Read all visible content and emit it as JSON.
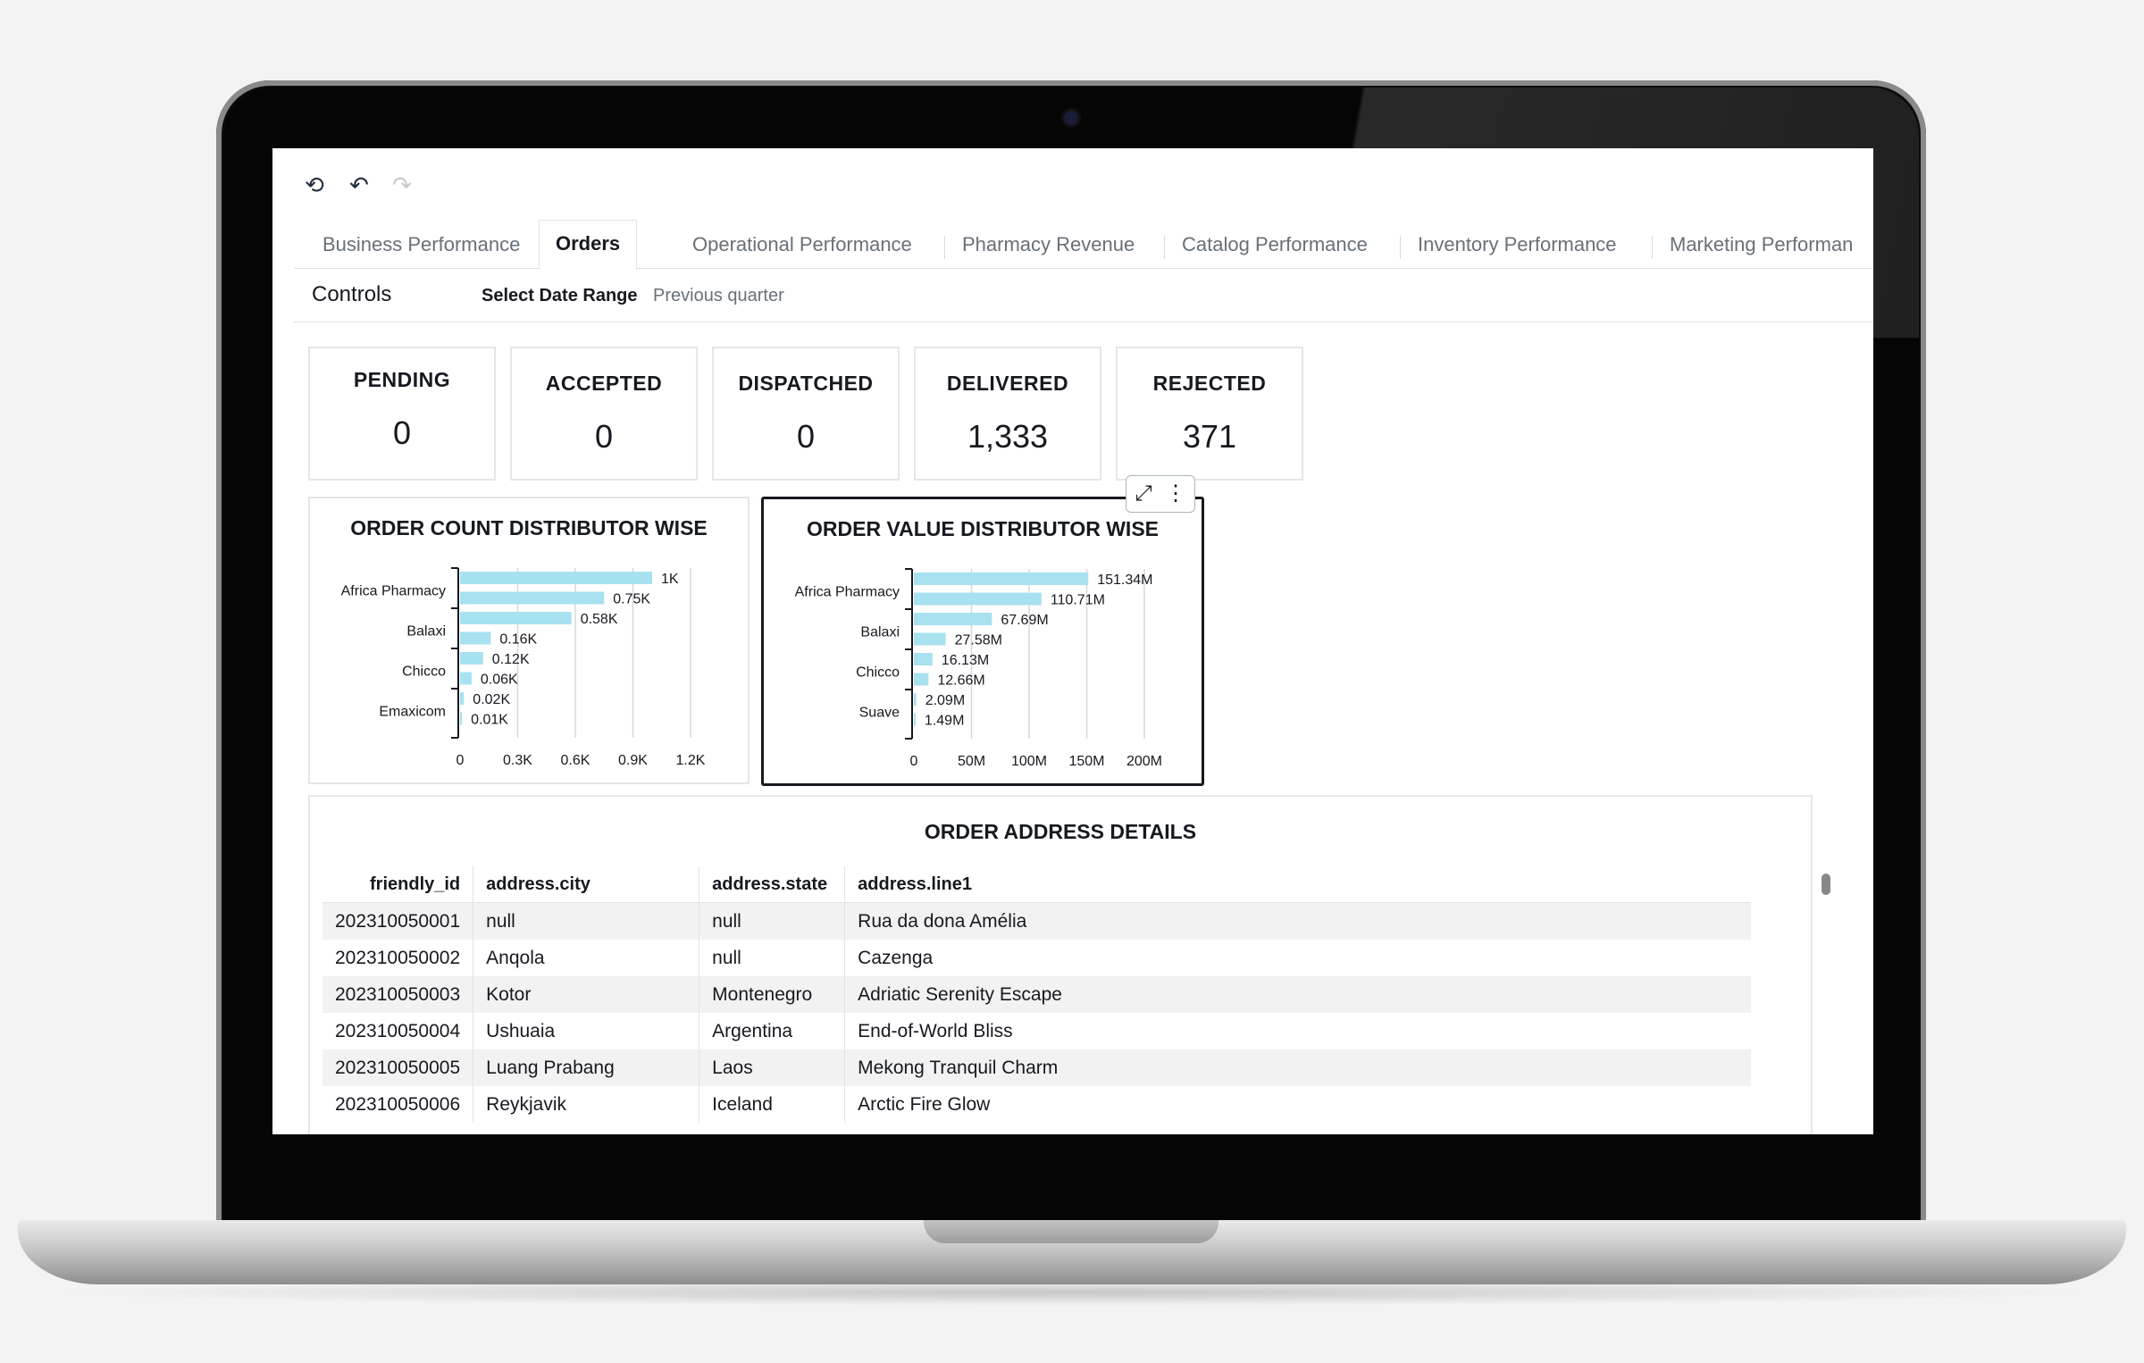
{
  "toolbar": {
    "icons": [
      "reset-icon",
      "undo-icon",
      "redo-icon"
    ]
  },
  "tabs": [
    {
      "label": "Business Performance"
    },
    {
      "label": "Orders"
    },
    {
      "label": "Operational Performance"
    },
    {
      "label": "Pharmacy Revenue"
    },
    {
      "label": "Catalog Performance"
    },
    {
      "label": "Inventory Performance"
    },
    {
      "label": "Marketing Performan"
    }
  ],
  "controls": {
    "title": "Controls",
    "date_label": "Select Date Range",
    "date_value": "Previous quarter"
  },
  "kpis": [
    {
      "title": "PENDING",
      "value": "0"
    },
    {
      "title": "ACCEPTED",
      "value": "0"
    },
    {
      "title": "DISPATCHED",
      "value": "0"
    },
    {
      "title": "DELIVERED",
      "value": "1,333"
    },
    {
      "title": "REJECTED",
      "value": "371"
    }
  ],
  "colors": {
    "bar": "#a8e1ef",
    "grid": "#d8d8d8",
    "axis": "#16191f",
    "text": "#16191f"
  },
  "chart_data": [
    {
      "type": "bar",
      "orientation": "horizontal",
      "title": "ORDER COUNT DISTRIBUTOR WISE",
      "y_tick_labels": [
        "Africa Pharmacy",
        "Balaxi",
        "Chicco",
        "Emaxicom"
      ],
      "values": [
        1000,
        750,
        580,
        160,
        120,
        60,
        20,
        10
      ],
      "data_labels": [
        "1K",
        "0.75K",
        "0.58K",
        "0.16K",
        "0.12K",
        "0.06K",
        "0.02K",
        "0.01K"
      ],
      "x_ticks": [
        "0",
        "0.3K",
        "0.6K",
        "0.9K",
        "1.2K"
      ],
      "xlim": [
        0,
        1200
      ]
    },
    {
      "type": "bar",
      "orientation": "horizontal",
      "title": "ORDER VALUE DISTRIBUTOR WISE",
      "y_tick_labels": [
        "Africa Pharmacy",
        "Balaxi",
        "Chicco",
        "Suave"
      ],
      "values": [
        151.34,
        110.71,
        67.69,
        27.58,
        16.13,
        12.66,
        2.09,
        1.49
      ],
      "data_labels": [
        "151.34M",
        "110.71M",
        "67.69M",
        "27.58M",
        "16.13M",
        "12.66M",
        "2.09M",
        "1.49M"
      ],
      "x_ticks": [
        "0",
        "50M",
        "100M",
        "150M",
        "200M"
      ],
      "xlim": [
        0,
        200
      ]
    }
  ],
  "table": {
    "title": "ORDER ADDRESS DETAILS",
    "columns": [
      "friendly_id",
      "address.city",
      "address.state",
      "address.line1"
    ],
    "rows": [
      [
        "202310050001",
        "null",
        "null",
        "Rua da dona Amélia"
      ],
      [
        "202310050002",
        "Anqola",
        "null",
        "Cazenga"
      ],
      [
        "202310050003",
        "Kotor",
        "Montenegro",
        "Adriatic Serenity Escape"
      ],
      [
        "202310050004",
        "Ushuaia",
        "Argentina",
        "End-of-World Bliss"
      ],
      [
        "202310050005",
        "Luang Prabang",
        "Laos",
        "Mekong Tranquil Charm"
      ],
      [
        "202310050006",
        "Reykjavik",
        "Iceland",
        "Arctic Fire Glow"
      ]
    ]
  }
}
